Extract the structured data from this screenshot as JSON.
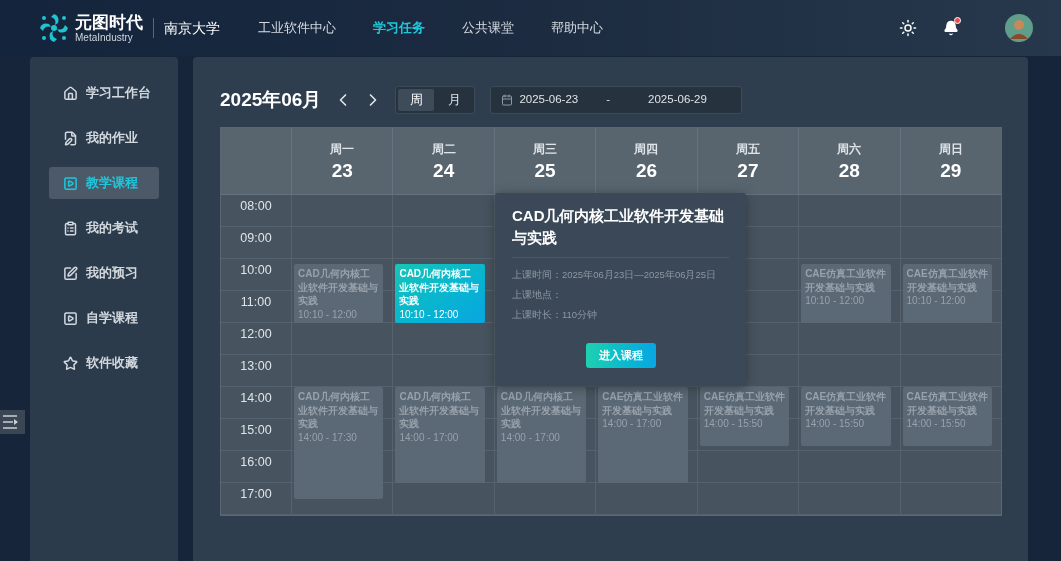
{
  "header": {
    "logo": {
      "name": "元图时代",
      "subtitle": "MetaIndustry"
    },
    "school": "南京大学",
    "nav": [
      {
        "label": "工业软件中心",
        "selected": false
      },
      {
        "label": "学习任务",
        "selected": true
      },
      {
        "label": "公共课堂",
        "selected": false
      },
      {
        "label": "帮助中心",
        "selected": false
      }
    ],
    "has_notification": true
  },
  "sidebar": {
    "items": [
      {
        "label": "学习工作台",
        "selected": false
      },
      {
        "label": "我的作业",
        "selected": false
      },
      {
        "label": "教学课程",
        "selected": true
      },
      {
        "label": "我的考试",
        "selected": false
      },
      {
        "label": "我的预习",
        "selected": false
      },
      {
        "label": "自学课程",
        "selected": false
      },
      {
        "label": "软件收藏",
        "selected": false
      }
    ]
  },
  "calendar": {
    "title": "2025年06月",
    "views": [
      {
        "label": "周",
        "selected": true
      },
      {
        "label": "月",
        "selected": false
      }
    ],
    "range": {
      "start": "2025-06-23",
      "separator": "-",
      "end": "2025-06-29"
    },
    "hours": [
      "08:00",
      "09:00",
      "10:00",
      "11:00",
      "12:00",
      "13:00",
      "14:00",
      "15:00",
      "16:00",
      "17:00"
    ],
    "days": [
      {
        "weekday": "周一",
        "date": "23",
        "events": [
          {
            "title": "CAD几何内核工业软件开发基础与实践",
            "time": "10:10 - 12:00",
            "selected": false
          },
          {
            "title": "CAD几何内核工业软件开发基础与实践",
            "time": "14:00 - 17:30",
            "selected": false
          }
        ]
      },
      {
        "weekday": "周二",
        "date": "24",
        "events": [
          {
            "title": "CAD几何内核工业软件开发基础与实践",
            "time": "10:10 - 12:00",
            "selected": true
          },
          {
            "title": "CAD几何内核工业软件开发基础与实践",
            "time": "14:00 - 17:00",
            "selected": false
          }
        ]
      },
      {
        "weekday": "周三",
        "date": "25",
        "events": [
          {
            "title": "CAD几何内核工业软件开发基础与实践",
            "time": "14:00 - 17:00",
            "selected": false
          }
        ]
      },
      {
        "weekday": "周四",
        "date": "26",
        "events": [
          {
            "title": "CAE仿真工业软件开发基础与实践",
            "time": "14:00 - 17:00",
            "selected": false
          }
        ]
      },
      {
        "weekday": "周五",
        "date": "27",
        "events": [
          {
            "title": "CAE仿真工业软件开发基础与实践",
            "time": "14:00 - 15:50",
            "selected": false
          }
        ]
      },
      {
        "weekday": "周六",
        "date": "28",
        "events": [
          {
            "title": "CAE仿真工业软件开发基础与实践",
            "time": "10:10 - 12:00",
            "selected": false
          },
          {
            "title": "CAE仿真工业软件开发基础与实践",
            "time": "14:00 - 15:50",
            "selected": false
          }
        ]
      },
      {
        "weekday": "周日",
        "date": "29",
        "events": [
          {
            "title": "CAE仿真工业软件开发基础与实践",
            "time": "10:10 - 12:00",
            "selected": false
          },
          {
            "title": "CAE仿真工业软件开发基础与实践",
            "time": "14:00 - 15:50",
            "selected": false
          }
        ]
      }
    ],
    "popover": {
      "title": "CAD几何内核工业软件开发基础与实践",
      "details": [
        {
          "label": "上课时间：",
          "value": "2025年06月23日—2025年06月25日"
        },
        {
          "label": "上课地点："
        },
        {
          "label": "上课时长：",
          "value": "110分钟"
        }
      ],
      "button": "进入课程"
    }
  }
}
